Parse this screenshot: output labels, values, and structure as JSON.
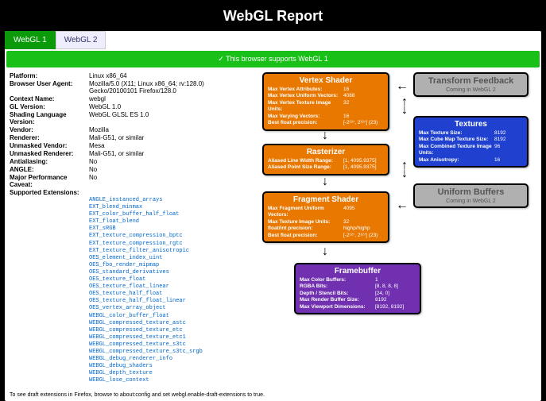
{
  "title": "WebGL Report",
  "tabs": {
    "webgl1": "WebGL 1",
    "webgl2": "WebGL 2"
  },
  "banner": "✓ This browser supports WebGL 1",
  "info": {
    "platform_lbl": "Platform:",
    "platform": "Linux x86_64",
    "ua_lbl": "Browser User Agent:",
    "ua": "Mozilla/5.0 (X11; Linux x86_64; rv:128.0) Gecko/20100101 Firefox/128.0",
    "ctx_lbl": "Context Name:",
    "ctx": "webgl",
    "glver_lbl": "GL Version:",
    "glver": "WebGL 1.0",
    "slver_lbl": "Shading Language Version:",
    "slver": "WebGL GLSL ES 1.0",
    "vendor_lbl": "Vendor:",
    "vendor": "Mozilla",
    "renderer_lbl": "Renderer:",
    "renderer": "Mali-G51, or similar",
    "uvendor_lbl": "Unmasked Vendor:",
    "uvendor": "Mesa",
    "urenderer_lbl": "Unmasked Renderer:",
    "urenderer": "Mali-G51, or similar",
    "aa_lbl": "Antialiasing:",
    "aa": "No",
    "angle_lbl": "ANGLE:",
    "angle": "No",
    "perf_lbl": "Major Performance Caveat:",
    "perf": "No",
    "ext_lbl": "Supported Extensions:"
  },
  "extensions": [
    "ANGLE_instanced_arrays",
    "EXT_blend_minmax",
    "EXT_color_buffer_half_float",
    "EXT_float_blend",
    "EXT_sRGB",
    "EXT_texture_compression_bptc",
    "EXT_texture_compression_rgtc",
    "EXT_texture_filter_anisotropic",
    "OES_element_index_uint",
    "OES_fbo_render_mipmap",
    "OES_standard_derivatives",
    "OES_texture_float",
    "OES_texture_float_linear",
    "OES_texture_half_float",
    "OES_texture_half_float_linear",
    "OES_vertex_array_object",
    "WEBGL_color_buffer_float",
    "WEBGL_compressed_texture_astc",
    "WEBGL_compressed_texture_etc",
    "WEBGL_compressed_texture_etc1",
    "WEBGL_compressed_texture_s3tc",
    "WEBGL_compressed_texture_s3tc_srgb",
    "WEBGL_debug_renderer_info",
    "WEBGL_debug_shaders",
    "WEBGL_depth_texture",
    "WEBGL_lose_context"
  ],
  "pipeline": {
    "vertex": {
      "title": "Vertex Shader",
      "rows": [
        [
          "Max Vertex Attributes:",
          "16"
        ],
        [
          "Max Vertex Uniform Vectors:",
          "4088"
        ],
        [
          "Max Vertex Texture Image Units:",
          "32"
        ],
        [
          "Max Varying Vectors:",
          "16"
        ],
        [
          "Best float precision:",
          "[-2¹²⁷, 2¹²⁷] (23)"
        ]
      ]
    },
    "tf": {
      "title": "Transform Feedback",
      "msg": "Coming in WebGL 2"
    },
    "textures": {
      "title": "Textures",
      "rows": [
        [
          "Max Texture Size:",
          "8192"
        ],
        [
          "Max Cube Map Texture Size:",
          "8192"
        ],
        [
          "Max Combined Texture Image Units:",
          "96"
        ],
        [
          "Max Anisotropy:",
          "16"
        ]
      ]
    },
    "raster": {
      "title": "Rasterizer",
      "rows": [
        [
          "Aliased Line Width Range:",
          "[1, 4095.9375]"
        ],
        [
          "Aliased Point Size Range:",
          "[1, 4095.9375]"
        ]
      ]
    },
    "fragment": {
      "title": "Fragment Shader",
      "rows": [
        [
          "Max Fragment Uniform Vectors:",
          "4095"
        ],
        [
          "Max Texture Image Units:",
          "32"
        ],
        [
          "float/int precision:",
          "highp/highp"
        ],
        [
          "Best float precision:",
          "[-2¹²⁷, 2¹²⁷] (23)"
        ]
      ]
    },
    "ub": {
      "title": "Uniform Buffers",
      "msg": "Coming in WebGL 2"
    },
    "fb": {
      "title": "Framebuffer",
      "rows": [
        [
          "Max Color Buffers:",
          "1"
        ],
        [
          "RGBA Bits:",
          "[8, 8, 8, 8]"
        ],
        [
          "Depth / Stencil Bits:",
          "[24, 0]"
        ],
        [
          "Max Render Buffer Size:",
          "8192"
        ],
        [
          "Max Viewport Dimensions:",
          "[8192, 8192]"
        ]
      ]
    }
  },
  "footer": "To see draft extensions in Firefox, browse to about:config and set webgl.enable-draft-extensions to true."
}
